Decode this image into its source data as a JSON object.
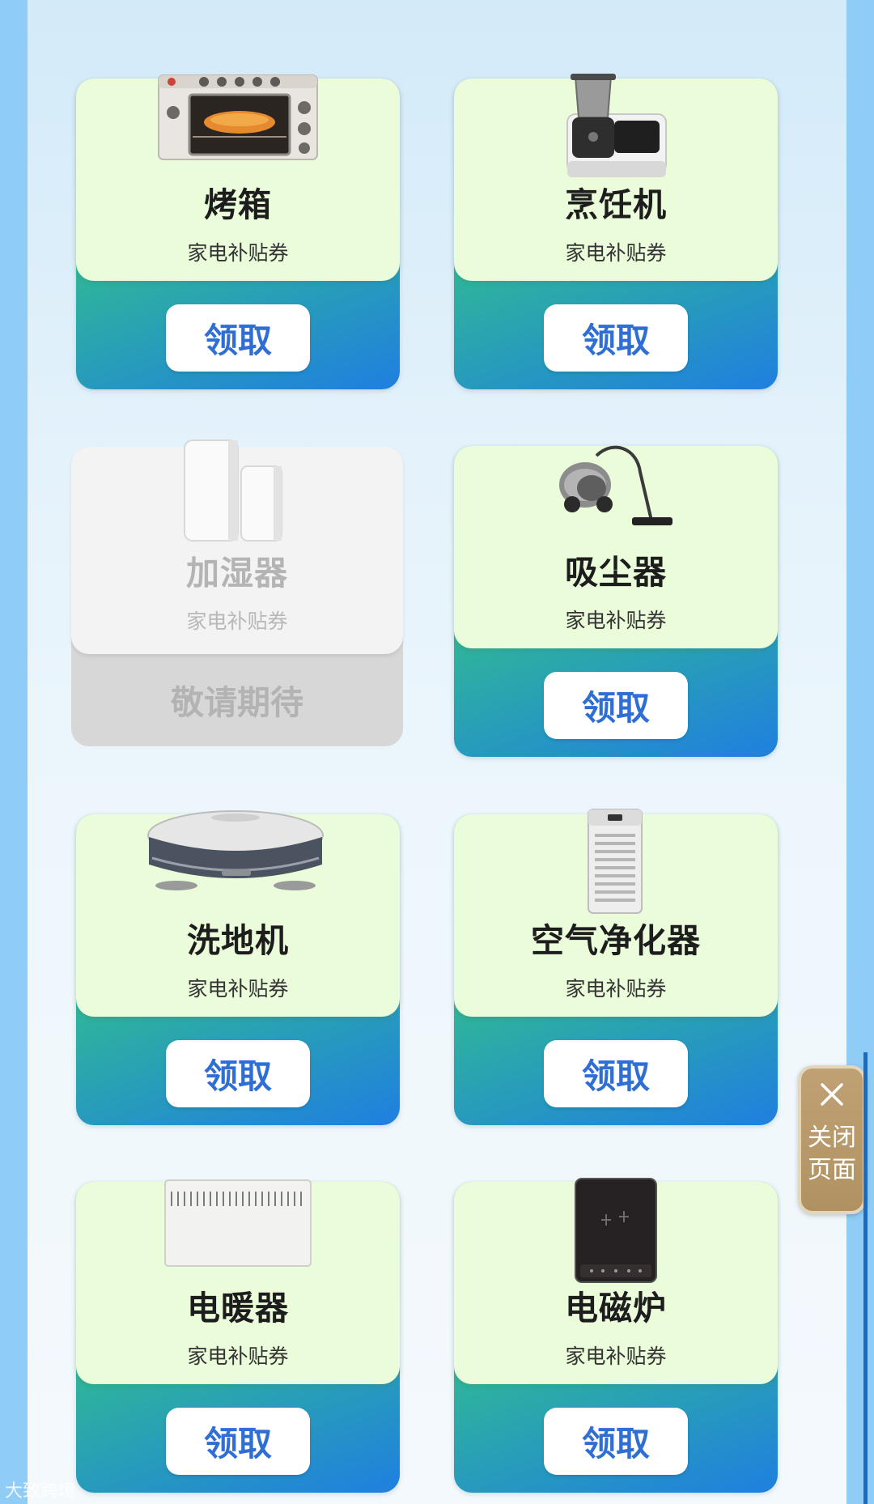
{
  "cards": [
    {
      "name": "烤箱",
      "subtitle": "家电补贴券",
      "button": "领取",
      "image": "oven-image"
    },
    {
      "name": "烹饪机",
      "subtitle": "家电补贴券",
      "button": "领取",
      "image": "cooking-machine-image"
    },
    {
      "name": "加湿器",
      "subtitle": "家电补贴券",
      "status": "敬请期待",
      "image": "humidifier-image"
    },
    {
      "name": "吸尘器",
      "subtitle": "家电补贴券",
      "button": "领取",
      "image": "vacuum-cleaner-image"
    },
    {
      "name": "洗地机",
      "subtitle": "家电补贴券",
      "button": "领取",
      "image": "floor-washer-image"
    },
    {
      "name": "空气净化器",
      "subtitle": "家电补贴券",
      "button": "领取",
      "image": "air-purifier-image"
    },
    {
      "name": "电暖器",
      "subtitle": "家电补贴券",
      "button": "领取",
      "image": "electric-heater-image"
    },
    {
      "name": "电磁炉",
      "subtitle": "家电补贴券",
      "button": "领取",
      "image": "induction-cooker-image"
    }
  ],
  "close_panel": {
    "icon": "close-icon",
    "label": "关闭页面"
  },
  "watermark": "大致跨境",
  "colors": {
    "card_top": "#eafcd9",
    "button_text": "#2f6ed3",
    "gradient_start": "#67d86a",
    "gradient_end": "#1f7fe0",
    "close_panel": "#b09262"
  }
}
